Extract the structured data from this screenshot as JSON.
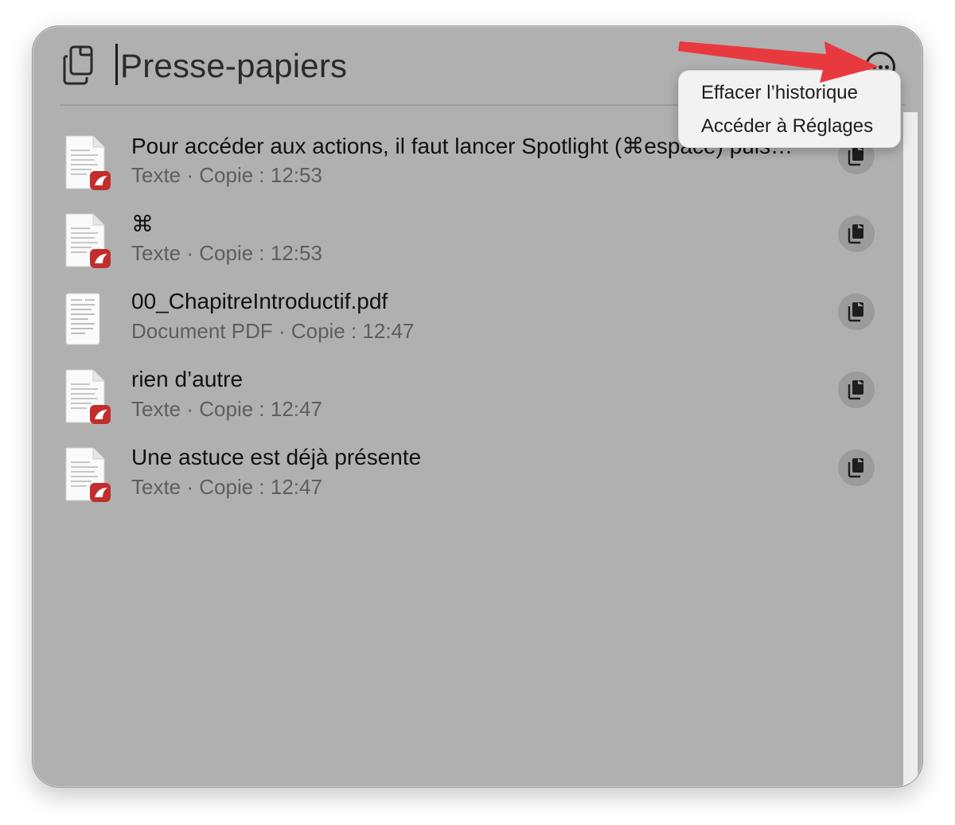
{
  "header": {
    "title": "Presse-papiers"
  },
  "menu": {
    "items": [
      {
        "label": "Effacer l’historique"
      },
      {
        "label": "Accéder à Réglages"
      }
    ]
  },
  "rows": [
    {
      "title": "Pour accéder aux actions, il faut lancer Spotlight (⌘espace) puis…",
      "subtitle": "Texte · Copie : 12:53",
      "icon": "text-document-icon"
    },
    {
      "title": "⌘",
      "subtitle": "Texte · Copie : 12:53",
      "icon": "text-document-icon"
    },
    {
      "title": "00_ChapitreIntroductif.pdf",
      "subtitle": "Document PDF · Copie : 12:47",
      "icon": "pdf-document-icon"
    },
    {
      "title": "rien d’autre",
      "subtitle": "Texte · Copie : 12:47",
      "icon": "text-document-icon"
    },
    {
      "title": "Une astuce est déjà présente",
      "subtitle": "Texte · Copie : 12:47",
      "icon": "text-document-icon"
    }
  ],
  "colors": {
    "window_bg": "#b0b0b0",
    "annotation_arrow": "#e8393f"
  }
}
